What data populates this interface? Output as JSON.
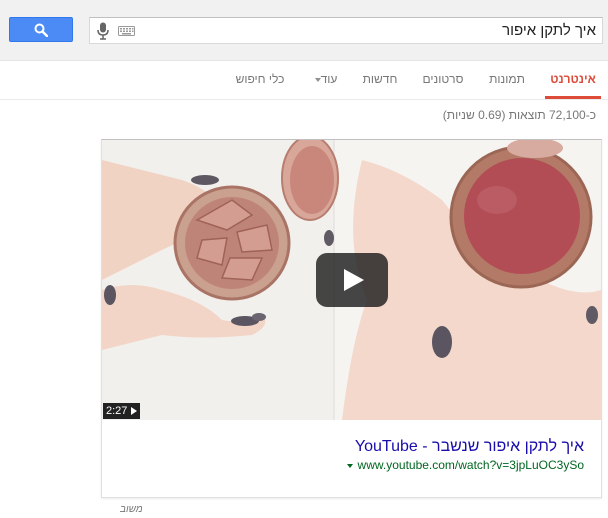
{
  "search": {
    "query": "איך לתקן איפור",
    "button_icon": "search-icon",
    "mic_icon": "microphone-icon",
    "keyboard_icon": "keyboard-icon"
  },
  "tabs": [
    {
      "label": "אינטרנט",
      "active": true
    },
    {
      "label": "תמונות"
    },
    {
      "label": "סרטונים"
    },
    {
      "label": "חדשות"
    },
    {
      "label": "עוד"
    },
    {
      "label": "כלי חיפוש"
    }
  ],
  "stats": "כ-72,100 תוצאות (0.69 שניות)",
  "result": {
    "title": "איך לתקן איפור שנשבר - YouTube",
    "url": "www.youtube.com/watch?v=3jpLuOC3ySo",
    "duration": "2:27"
  },
  "feedback_label": "משוב",
  "colors": {
    "accent_red": "#dd4b39",
    "button_blue": "#4c8bf5",
    "link_blue": "#1a0dab",
    "url_green": "#006621"
  }
}
